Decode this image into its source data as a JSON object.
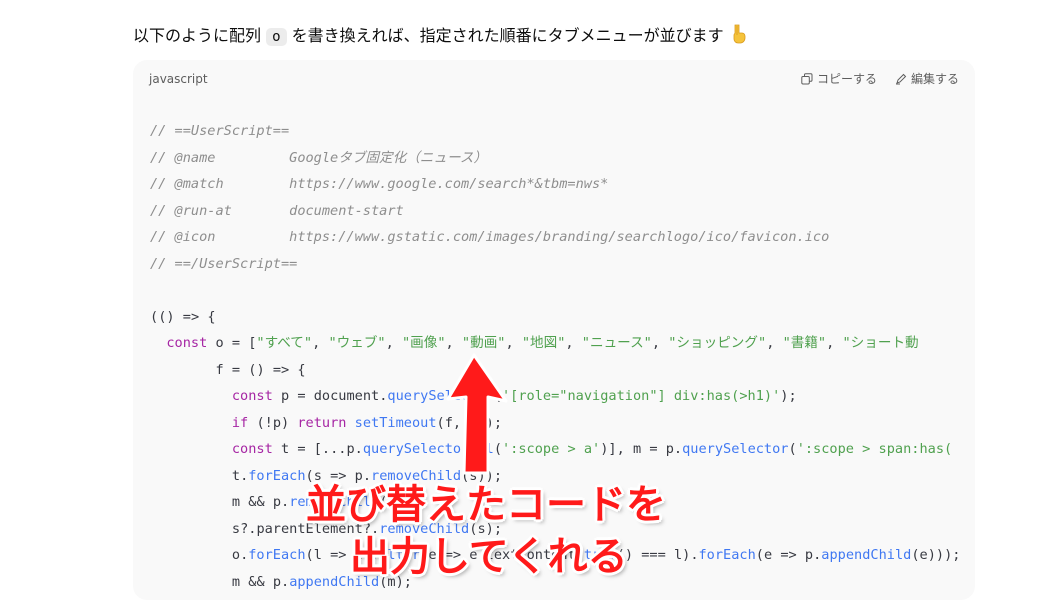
{
  "intro": {
    "before": "以下のように配列 ",
    "code": "o",
    "after": " を書き換えれば、指定された順番にタブメニューが並びます"
  },
  "code_block": {
    "language": "javascript",
    "copy_label": "コピーする",
    "edit_label": "編集する",
    "lines": [
      "// ==UserScript==",
      "// @name         Googleタブ固定化（ニュース）",
      "// @match        https://www.google.com/search*&tbm=nws*",
      "// @run-at       document-start",
      "// @icon         https://www.gstatic.com/images/branding/searchlogo/ico/favicon.ico",
      "// ==/UserScript==",
      "",
      "(() => {",
      "  const o = [\"すべて\", \"ウェブ\", \"画像\", \"動画\", \"地図\", \"ニュース\", \"ショッピング\", \"書籍\", \"ショート動",
      "        f = () => {",
      "          const p = document.querySelector('[role=\"navigation\"] div:has(>h1)');",
      "          if (!p) return setTimeout(f, 10);",
      "          const t = [...p.querySelectorAll(':scope > a')], m = p.querySelector(':scope > span:has(",
      "          t.forEach(s => p.removeChild(s));",
      "          m && p.removeChild(m);",
      "          s?.parentElement?.removeChild(s);",
      "          o.forEach(l => t.filter(e => e.textContent.trim() === l).forEach(e => p.appendChild(e)));",
      "          m && p.appendChild(m);"
    ]
  },
  "annotation": {
    "line1": "並び替えたコードを",
    "line2": "出力してくれる",
    "color": "#ff1a1a"
  },
  "icons": [
    "pointing-down-emoji",
    "copy-icon",
    "edit-icon",
    "red-arrow"
  ]
}
